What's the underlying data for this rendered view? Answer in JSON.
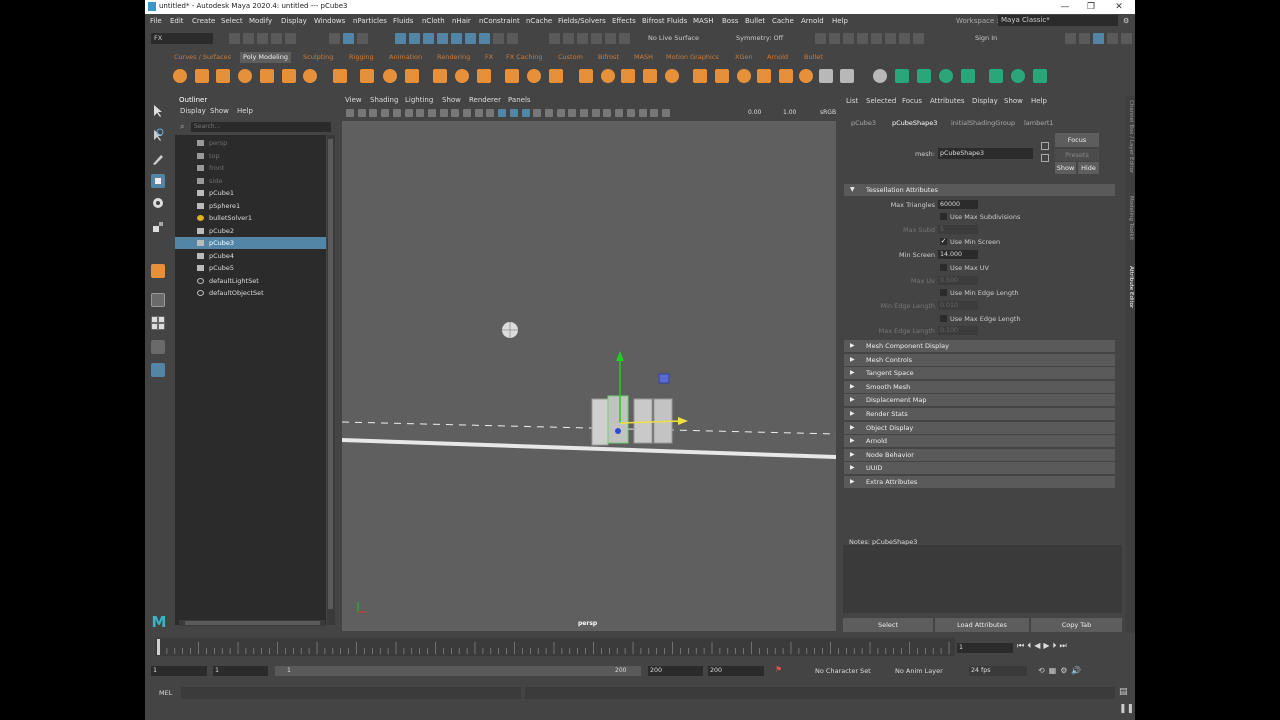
{
  "window": {
    "title": "untitled* - Autodesk Maya 2020.4: untitled   ---   pCube3",
    "controls": [
      "—",
      "❐",
      "✕"
    ]
  },
  "menubar": {
    "items": [
      "File",
      "Edit",
      "Create",
      "Select",
      "Modify",
      "Display",
      "Windows",
      "nParticles",
      "Fluids",
      "nCloth",
      "nHair",
      "nConstraint",
      "nCache",
      "Fields/Solvers",
      "Effects",
      "Bifrost Fluids",
      "MASH",
      "Boss",
      "Bullet",
      "Cache",
      "Arnold",
      "Help"
    ],
    "workspace_label": "Workspace :",
    "workspace_value": "Maya Classic*"
  },
  "statusline": {
    "menu_set": "FX",
    "live_surface": "No Live Surface",
    "symmetry": "Symmetry: Off",
    "sign_in": "Sign In"
  },
  "shelf": {
    "tabs": [
      "Curves / Surfaces",
      "Poly Modeling",
      "Sculpting",
      "Rigging",
      "Animation",
      "Rendering",
      "FX",
      "FX Caching",
      "Custom",
      "Bifrost",
      "MASH",
      "Motion Graphics",
      "XGen",
      "Arnold",
      "Bullet"
    ],
    "active_tab": "Poly Modeling"
  },
  "outliner": {
    "title": "Outliner",
    "menu": [
      "Display",
      "Show",
      "Help"
    ],
    "search_placeholder": "Search...",
    "items": [
      {
        "label": "persp",
        "dim": true,
        "icon": "camera-icon"
      },
      {
        "label": "top",
        "dim": true,
        "icon": "camera-icon"
      },
      {
        "label": "front",
        "dim": true,
        "icon": "camera-icon"
      },
      {
        "label": "side",
        "dim": true,
        "icon": "camera-icon"
      },
      {
        "label": "pCube1",
        "dim": false,
        "icon": "mesh-icon"
      },
      {
        "label": "pSphere1",
        "dim": false,
        "icon": "mesh-icon"
      },
      {
        "label": "bulletSolver1",
        "dim": false,
        "icon": "solver-icon"
      },
      {
        "label": "pCube2",
        "dim": false,
        "icon": "mesh-icon"
      },
      {
        "label": "pCube3",
        "dim": false,
        "icon": "mesh-icon",
        "selected": true
      },
      {
        "label": "pCube4",
        "dim": false,
        "icon": "mesh-icon"
      },
      {
        "label": "pCube5",
        "dim": false,
        "icon": "mesh-icon"
      },
      {
        "label": "defaultLightSet",
        "dim": false,
        "icon": "set-icon"
      },
      {
        "label": "defaultObjectSet",
        "dim": false,
        "icon": "set-icon"
      }
    ]
  },
  "viewport": {
    "menu": [
      "View",
      "Shading",
      "Lighting",
      "Show",
      "Renderer",
      "Panels"
    ],
    "exposure": "0.00",
    "gamma": "1.00",
    "color_space": "sRGB",
    "camera_label": "persp"
  },
  "attribute_editor": {
    "menu": [
      "List",
      "Selected",
      "Focus",
      "Attributes",
      "Display",
      "Show",
      "Help"
    ],
    "tabs": [
      "pCube3",
      "pCubeShape3",
      "initialShadingGroup",
      "lambert1"
    ],
    "active_tab": "pCubeShape3",
    "mesh_label": "mesh:",
    "mesh_value": "pCubeShape3",
    "focus_button": "Focus",
    "presets_button": "Presets",
    "show_button": "Show",
    "hide_button": "Hide",
    "tessellation": {
      "header": "Tessellation Attributes",
      "max_triangles_label": "Max Triangles",
      "max_triangles_value": "60000",
      "use_max_subdivisions": "Use Max Subdivisions",
      "max_subd_label": "Max Subd",
      "max_subd_value": "5",
      "use_min_screen": "Use Min Screen",
      "min_screen_label": "Min Screen",
      "min_screen_value": "14.000",
      "use_max_uv": "Use Max UV",
      "max_uv_label": "Max Uv",
      "max_uv_value": "0.500",
      "use_min_edge_length": "Use Min Edge Length",
      "min_edge_length_label": "Min Edge Length",
      "min_edge_length_value": "0.010",
      "use_max_edge_length": "Use Max Edge Length",
      "max_edge_length_label": "Max Edge Length",
      "max_edge_length_value": "0.100"
    },
    "sections": [
      "Mesh Component Display",
      "Mesh Controls",
      "Tangent Space",
      "Smooth Mesh",
      "Displacement Map",
      "Render Stats",
      "Object Display",
      "Arnold",
      "Node Behavior",
      "UUID",
      "Extra Attributes"
    ],
    "notes_label": "Notes:  pCubeShape3",
    "bottom_buttons": [
      "Select",
      "Load Attributes",
      "Copy Tab"
    ],
    "side_tabs": [
      "Channel Box / Layer Editor",
      "Modeling Toolkit",
      "Attribute Editor"
    ]
  },
  "timeline": {
    "current_frame": "1",
    "range_start": "1",
    "range_inner_start": "1",
    "range_slider_start": "1",
    "range_slider_end": "200",
    "range_inner_end": "200",
    "range_end": "200",
    "character_set": "No Character Set",
    "anim_layer": "No Anim Layer",
    "fps": "24 fps"
  },
  "command_line": {
    "language": "MEL"
  },
  "colors": {
    "selection": "#5285a6",
    "shelf_icon": "#e6913a",
    "shelf_tab_text": "#c87d3f"
  }
}
